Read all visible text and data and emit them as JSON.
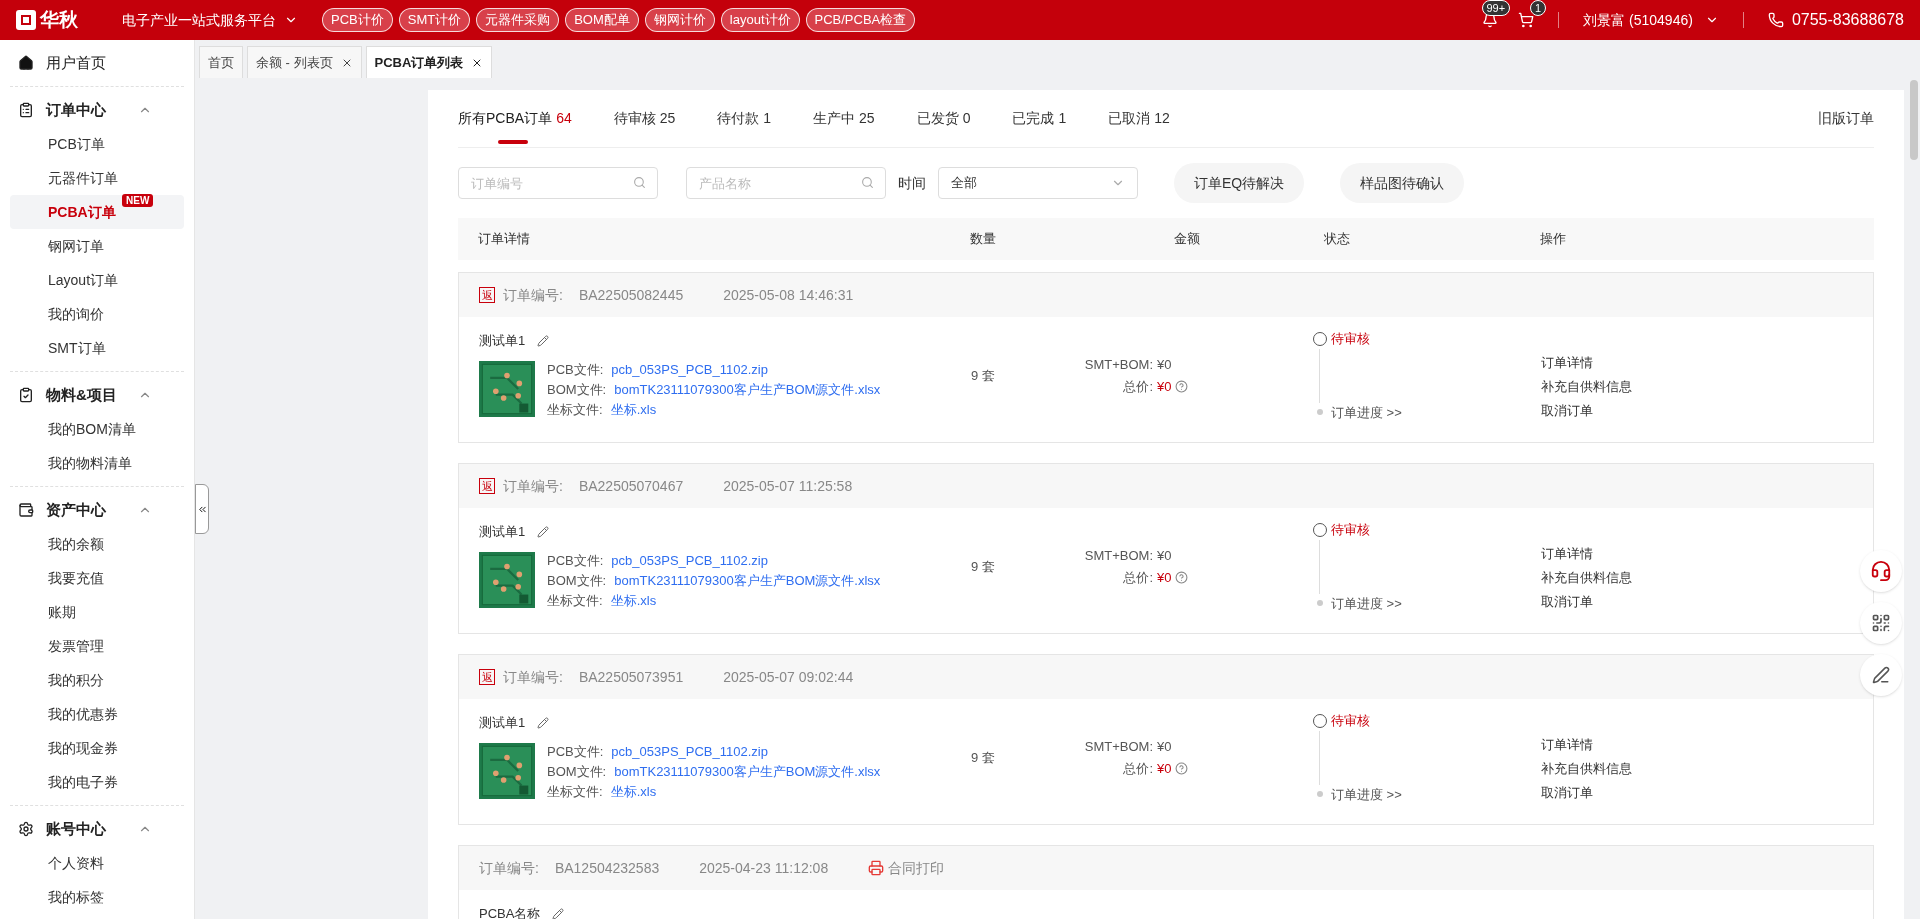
{
  "header": {
    "logo": "华秋",
    "platform": "电子产业一站式服务平台",
    "nav": [
      "PCB计价",
      "SMT计价",
      "元器件采购",
      "BOM配单",
      "钢网计价",
      "layout计价",
      "PCB/PCBA检查"
    ],
    "bell_badge": "99+",
    "cart_badge": "1",
    "user": "刘景富 (5104946)",
    "phone": "0755-83688678"
  },
  "sidebar": {
    "home": {
      "label": "用户首页",
      "selected": false
    },
    "sections": [
      {
        "title": "订单中心",
        "expanded": true,
        "items": [
          {
            "label": "PCB订单",
            "selected": false
          },
          {
            "label": "元器件订单",
            "selected": false
          },
          {
            "label": "PCBA订单",
            "selected": true,
            "badge": "NEW"
          },
          {
            "label": "钢网订单",
            "selected": false
          },
          {
            "label": "Layout订单",
            "selected": false
          },
          {
            "label": "我的询价",
            "selected": false
          },
          {
            "label": "SMT订单",
            "selected": false
          }
        ]
      },
      {
        "title": "物料&项目",
        "expanded": true,
        "items": [
          {
            "label": "我的BOM清单",
            "selected": false
          },
          {
            "label": "我的物料清单",
            "selected": false
          }
        ]
      },
      {
        "title": "资产中心",
        "expanded": true,
        "items": [
          {
            "label": "我的余额",
            "selected": false
          },
          {
            "label": "我要充值",
            "selected": false
          },
          {
            "label": "账期",
            "selected": false
          },
          {
            "label": "发票管理",
            "selected": false
          },
          {
            "label": "我的积分",
            "selected": false
          },
          {
            "label": "我的优惠券",
            "selected": false
          },
          {
            "label": "我的现金券",
            "selected": false
          },
          {
            "label": "我的电子券",
            "selected": false
          }
        ]
      },
      {
        "title": "账号中心",
        "expanded": true,
        "items": [
          {
            "label": "个人资料",
            "selected": false
          },
          {
            "label": "我的标签",
            "selected": false
          }
        ]
      }
    ]
  },
  "page_tabs": [
    {
      "label": "首页",
      "selected": false,
      "closable": false
    },
    {
      "label": "余额 - 列表页",
      "selected": false,
      "closable": true
    },
    {
      "label": "PCBA订单列表",
      "selected": true,
      "closable": true
    }
  ],
  "order_tabs": [
    {
      "label": "所有PCBA订单",
      "count": "64",
      "selected": true
    },
    {
      "label": "待审核",
      "count": "25",
      "selected": false
    },
    {
      "label": "待付款",
      "count": "1",
      "selected": false
    },
    {
      "label": "生产中",
      "count": "25",
      "selected": false
    },
    {
      "label": "已发货",
      "count": "0",
      "selected": false
    },
    {
      "label": "已完成",
      "count": "1",
      "selected": false
    },
    {
      "label": "已取消",
      "count": "12",
      "selected": false
    }
  ],
  "old_orders": "旧版订单",
  "filters": {
    "order_no": {
      "placeholder": "订单编号"
    },
    "product": {
      "placeholder": "产品名称"
    },
    "time_label": "时间",
    "time_value": "全部",
    "buttons": [
      "订单EQ待解决",
      "样品图待确认"
    ]
  },
  "columns": [
    "订单详情",
    "数量",
    "金额",
    "状态",
    "操作"
  ],
  "orders": [
    {
      "kind": "rebate",
      "tag": "返",
      "no_label": "订单编号:",
      "no": "BA22505082445",
      "time": "2025-05-08 14:46:31",
      "name": "测试单1",
      "files": [
        {
          "label": "PCB文件:",
          "value": "pcb_053PS_PCB_1102.zip"
        },
        {
          "label": "BOM文件:",
          "value": "bomTK23111079300客户生产BOM源文件.xlsx"
        },
        {
          "label": "坐标文件:",
          "value": "坐标.xls"
        }
      ],
      "qty": "9 套",
      "smt_label": "SMT+BOM:",
      "smt": "¥0",
      "total_label": "总价:",
      "total": "¥0",
      "status": "待审核",
      "progress": "订单进度 >>",
      "actions": [
        "订单详情",
        "补充自供料信息",
        "取消订单"
      ]
    },
    {
      "kind": "rebate",
      "tag": "返",
      "no_label": "订单编号:",
      "no": "BA22505070467",
      "time": "2025-05-07 11:25:58",
      "name": "测试单1",
      "files": [
        {
          "label": "PCB文件:",
          "value": "pcb_053PS_PCB_1102.zip"
        },
        {
          "label": "BOM文件:",
          "value": "bomTK23111079300客户生产BOM源文件.xlsx"
        },
        {
          "label": "坐标文件:",
          "value": "坐标.xls"
        }
      ],
      "qty": "9 套",
      "smt_label": "SMT+BOM:",
      "smt": "¥0",
      "total_label": "总价:",
      "total": "¥0",
      "status": "待审核",
      "progress": "订单进度 >>",
      "actions": [
        "订单详情",
        "补充自供料信息",
        "取消订单"
      ]
    },
    {
      "kind": "rebate",
      "tag": "返",
      "no_label": "订单编号:",
      "no": "BA22505073951",
      "time": "2025-05-07 09:02:44",
      "name": "测试单1",
      "files": [
        {
          "label": "PCB文件:",
          "value": "pcb_053PS_PCB_1102.zip"
        },
        {
          "label": "BOM文件:",
          "value": "bomTK23111079300客户生产BOM源文件.xlsx"
        },
        {
          "label": "坐标文件:",
          "value": "坐标.xls"
        }
      ],
      "qty": "9 套",
      "smt_label": "SMT+BOM:",
      "smt": "¥0",
      "total_label": "总价:",
      "total": "¥0",
      "status": "待审核",
      "progress": "订单进度 >>",
      "actions": [
        "订单详情",
        "补充自供料信息",
        "取消订单"
      ]
    },
    {
      "kind": "contract",
      "no_label": "订单编号:",
      "no": "BA12504232583",
      "time": "2025-04-23 11:12:08",
      "contract": "合同打印",
      "name": "PCBA名称"
    }
  ]
}
